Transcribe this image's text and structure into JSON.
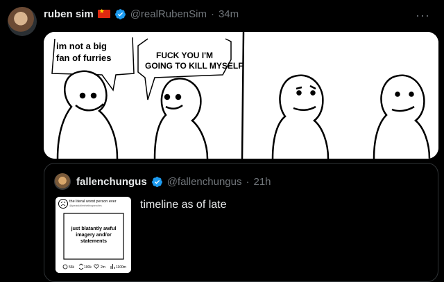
{
  "tweet": {
    "author_name": "ruben sim",
    "handle": "@realRubenSim",
    "separator": "·",
    "time": "34m",
    "more_icon": "more-horizontal-icon"
  },
  "comic": {
    "panel1_bubble_left": "im not a big fan of furries",
    "panel1_bubble_left_lines": [
      "im not a big",
      "fan of furries"
    ],
    "panel1_bubble_right_lines": [
      "FUCK YOU I'M",
      "GOING TO KILL MYSELF"
    ]
  },
  "quote": {
    "author_name": "fallenchungus",
    "handle": "@fallenchungus",
    "separator": "·",
    "time": "21h",
    "text": "timeline as of late",
    "thumb": {
      "header_name": "the literal worst person ever",
      "header_handle": "@greatyfallenthethingsexcites",
      "body": "just blatantly awful imagery and/or statements",
      "stats": [
        "56k",
        "100k",
        "2m",
        "1100m"
      ]
    }
  },
  "colors": {
    "background": "#000000",
    "text": "#e7e9ea",
    "muted": "#71767b",
    "verified": "#1d9bf0",
    "border": "#2f3336"
  }
}
